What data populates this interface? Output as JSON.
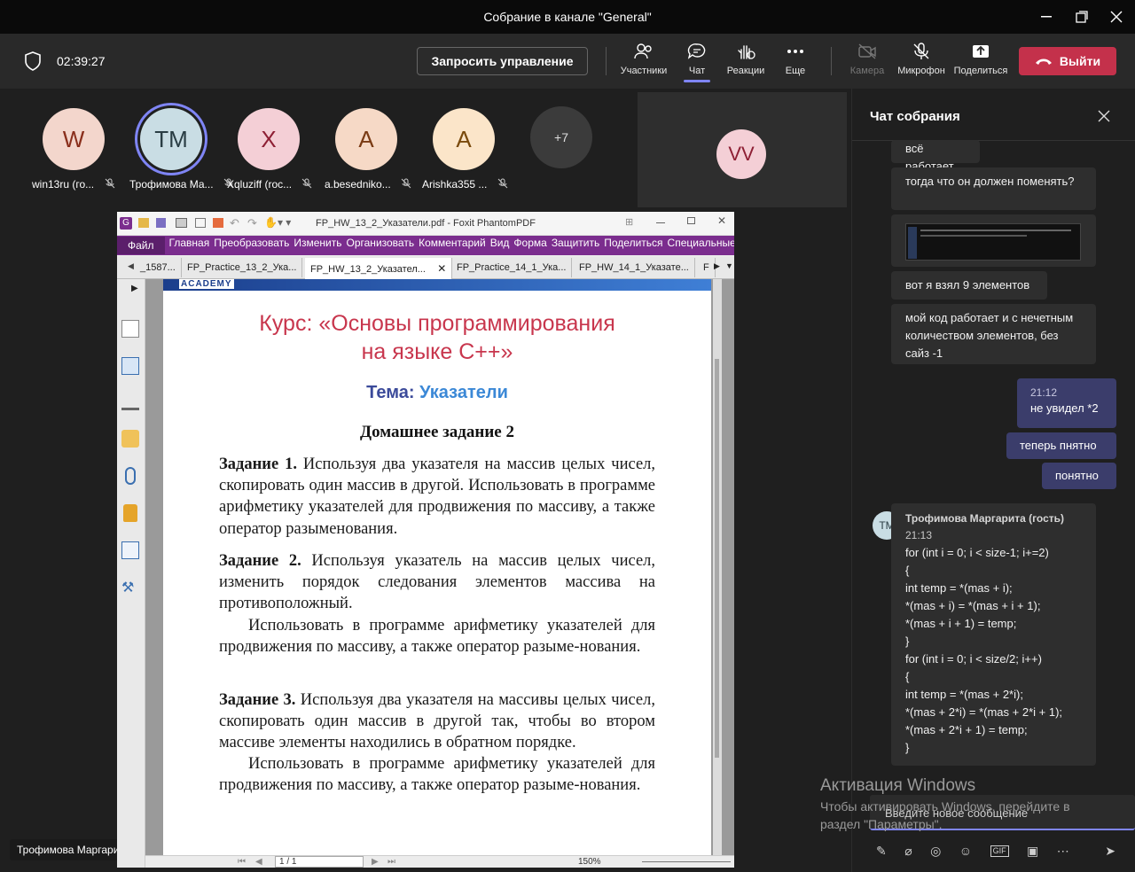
{
  "window": {
    "title": "Собрание в канале \"General\""
  },
  "meeting": {
    "timer": "02:39:27",
    "request_control": "Запросить управление",
    "buttons": {
      "participants": "Участники",
      "chat": "Чат",
      "reactions": "Реакции",
      "more": "Еще",
      "camera": "Камера",
      "mic": "Микрофон",
      "share": "Поделиться",
      "leave": "Выйти"
    }
  },
  "participants": [
    {
      "initials": "W",
      "name": "win13ru (го...",
      "bg": "#f3d6cc",
      "fg": "#8a2f1c"
    },
    {
      "initials": "TM",
      "name": "Трофимова Ма...",
      "bg": "#c9dde4",
      "fg": "#2a3d44"
    },
    {
      "initials": "X",
      "name": "Xqluziff (roc...",
      "bg": "#f4cfd6",
      "fg": "#8e1f34"
    },
    {
      "initials": "A",
      "name": "a.besedniko...",
      "bg": "#f6d9c6",
      "fg": "#7a3b14"
    },
    {
      "initials": "A",
      "name": "Arishka355 ...",
      "bg": "#fbe5c9",
      "fg": "#7a4a0c"
    }
  ],
  "more_participants": "+7",
  "self_tile": {
    "initials": "VV"
  },
  "presenter_label": "Трофимова Маргарита (гость)",
  "chat": {
    "title": "Чат собрания",
    "messages": [
      "всё работает",
      "тогда что он должен поменять?",
      "вот я взял 9 элементов",
      "мой код работает и с нечетным количеством элементов, без сайз -1"
    ],
    "mine": {
      "time": "21:12",
      "text": "не увидел *2",
      "m2": "теперь пнятно",
      "m3": "понятно"
    },
    "last": {
      "sender": "Трофимова Маргарита (гость)",
      "time": "21:13",
      "initials": "ТМ",
      "code": [
        "for (int i = 0; i < size-1; i+=2)",
        "{",
        "int temp = *(mas + i);",
        "*(mas + i) = *(mas + i + 1);",
        "*(mas + i + 1) = temp;",
        "}",
        "for (int i = 0; i < size/2; i++)",
        "{",
        "int temp = *(mas + 2*i);",
        "*(mas + 2*i) = *(mas + 2*i + 1);",
        "*(mas + 2*i + 1) = temp;",
        "}"
      ]
    },
    "input_placeholder": "Введите новое сообщение"
  },
  "activation": {
    "title": "Активация Windows",
    "line1": "Чтобы активировать Windows, перейдите в",
    "line2": "раздел \"Параметры\"."
  },
  "pdf": {
    "title": "FP_HW_13_2_Указатели.pdf - Foxit PhantomPDF",
    "menu": [
      "Файл",
      "Главная",
      "Преобразовать",
      "Изменить",
      "Организовать",
      "Комментарий",
      "Вид",
      "Форма",
      "Защитить",
      "Поделиться",
      "Специальные возмо"
    ],
    "tabs": [
      "_1587...",
      "FP_Practice_13_2_Ука...",
      "FP_HW_13_2_Указател...",
      "FP_Practice_14_1_Ука...",
      "FP_HW_14_1_Указате...",
      "F"
    ],
    "banner": "ACADEMY",
    "course_line1": "Курс: «Основы программирования",
    "course_line2": "на языке С++»",
    "topic_label": "Тема:",
    "topic_value": "Указатели",
    "hw_title": "Домашнее задание 2",
    "t1_label": "Задание 1.",
    "t1_text": " Используя два указателя на массив целых чисел, скопировать один массив в другой. Использовать в программе арифметику указателей для продвижения по массиву, а также оператор разыменования.",
    "t2_label": "Задание 2.",
    "t2_text": " Используя указатель на массив целых чисел, изменить порядок следования элементов массива на противоположный.",
    "t2_extra": "Использовать в программе арифметику указателей для продвижения по массиву, а также оператор разыме-нования.",
    "t3_label": "Задание 3.",
    "t3_text": " Используя два указателя на массивы целых чисел, скопировать один массив в другой так, чтобы во втором массиве элементы находились в обратном порядке.",
    "t3_extra": "Использовать в программе арифметику указателей для продвижения по массиву, а также оператор разыме-нования.",
    "page": "1 / 1",
    "zoom": "150%"
  }
}
